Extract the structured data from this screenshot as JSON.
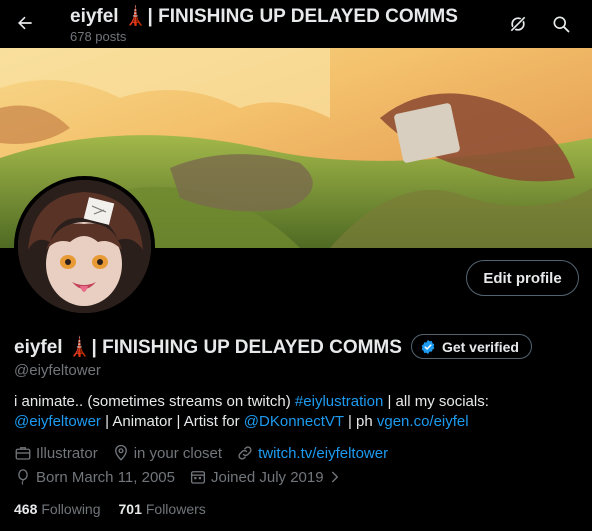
{
  "header": {
    "title": "eiyfel 🗼| FINISHING UP DELAYED COMMS",
    "post_count": "678 posts"
  },
  "profile": {
    "display_name": "eiyfel 🗼| FINISHING UP DELAYED COMMS",
    "handle": "@eiyfeltower",
    "edit_profile_label": "Edit profile",
    "get_verified_label": "Get verified"
  },
  "bio": {
    "part1": "i animate.. (sometimes streams on twitch) ",
    "hashtag": "#eiylustration",
    "part2": " | all my socials: ",
    "mention1": "@eiyfeltower",
    "part3": " | Animator | Artist for ",
    "mention2": "@DKonnectVT",
    "part4": " | ph ",
    "link": "vgen.co/eiyfel"
  },
  "meta": {
    "category": "Illustrator",
    "location": "in your closet",
    "website": "twitch.tv/eiyfeltower",
    "birthday": "Born March 11, 2005",
    "joined": "Joined July 2019"
  },
  "stats": {
    "following_count": "468",
    "following_label": "Following",
    "followers_count": "701",
    "followers_label": "Followers"
  },
  "colors": {
    "background": "#000000",
    "text": "#e7e9ea",
    "muted": "#71767b",
    "accent": "#1d9bf0",
    "border": "#536471"
  }
}
